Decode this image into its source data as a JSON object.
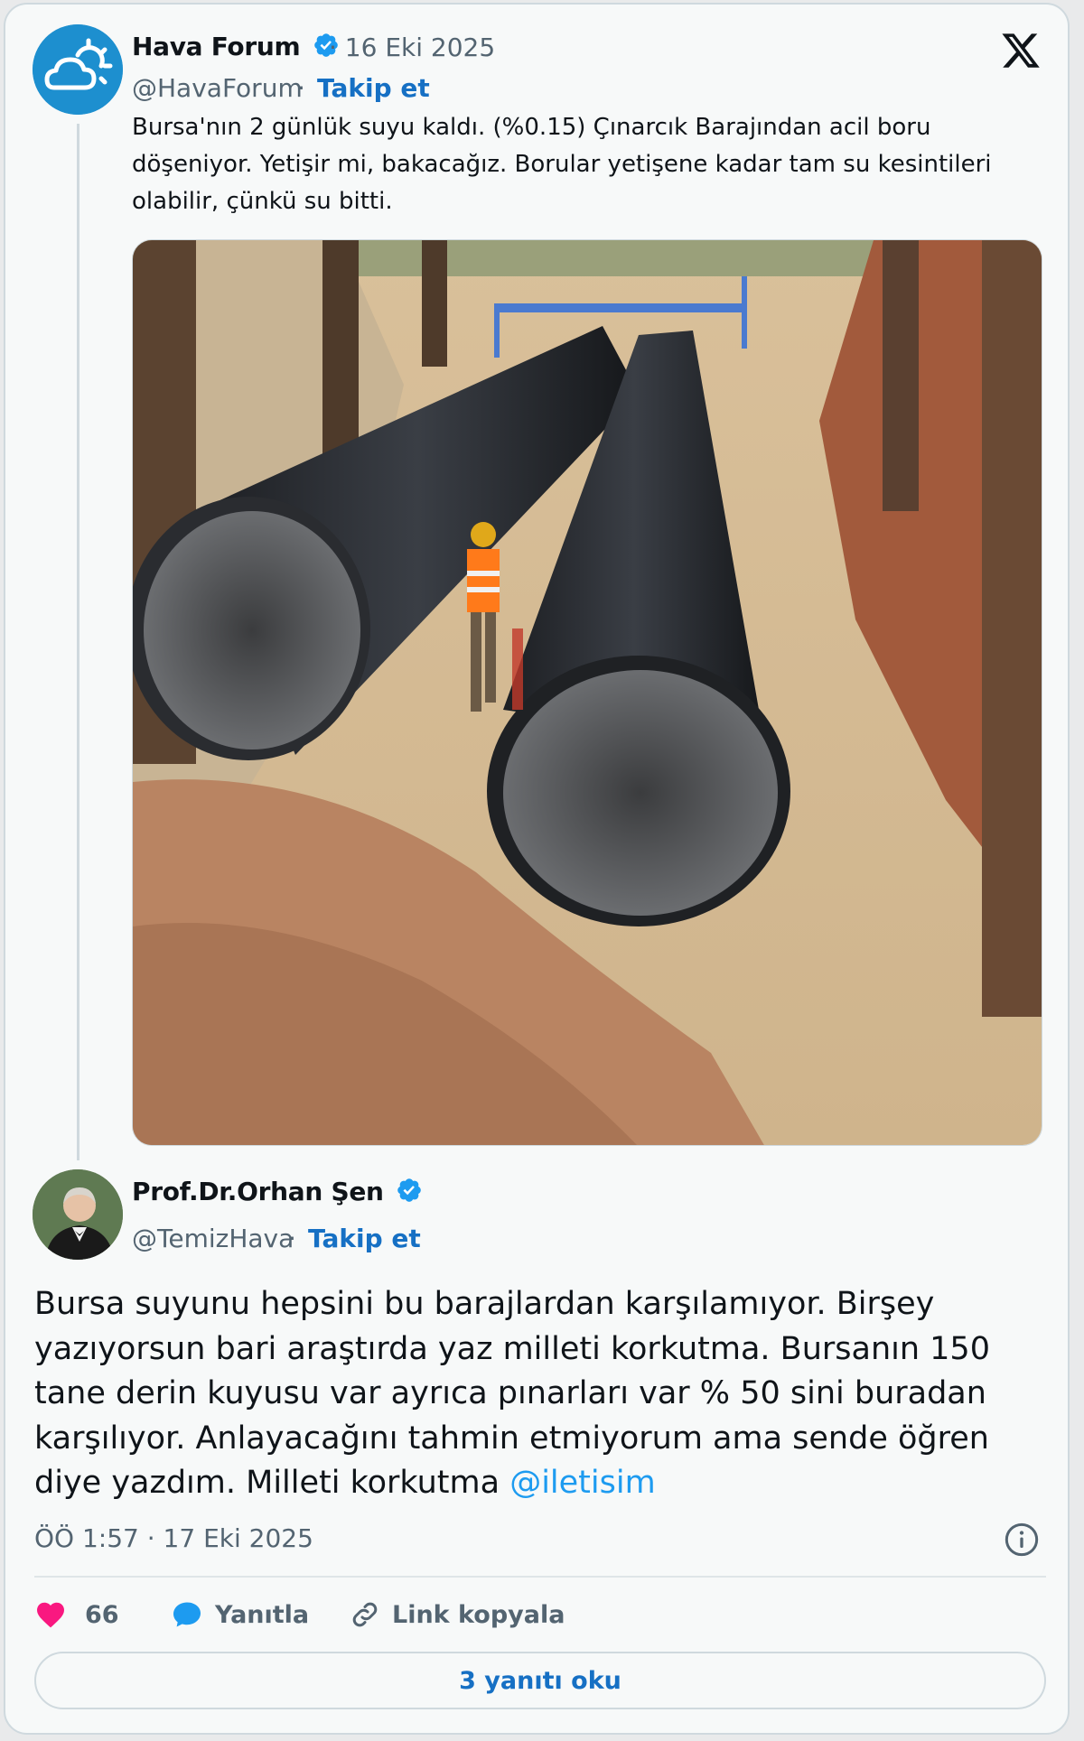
{
  "parent_tweet": {
    "author_name": "Hava Forum",
    "date": "· 16 Eki 2025",
    "handle": "@HavaForum",
    "separator": "·",
    "follow_label": "Takip et",
    "text": "Bursa'nın 2 günlük suyu kaldı. (%0.15) Çınarcık Barajından acil boru döşeniyor. Yetişir mi, bakacağız. Borular yetişene kadar tam su kesintileri olabilir, çünkü su bitti.",
    "avatar_icon": "cloud-sun-icon",
    "photo_icon": "pipeline-trench-photo"
  },
  "reply_tweet": {
    "author_name": "Prof.Dr.Orhan Şen",
    "handle": "@TemizHava",
    "separator": "·",
    "follow_label": "Takip et",
    "text": "Bursa suyunu hepsini bu barajlardan karşılamıyor. Birşey yazıyorsun bari araştırda yaz milleti korkutma. Bursanın 150 tane derin kuyusu var ayrıca pınarları var % 50 sini buradan karşılıyor.  Anlayacağını tahmin etmiyorum ama sende öğren diye yazdım. Milleti korkutma ",
    "mention": "@iletisim",
    "timestamp": "ÖÖ 1:57 · 17 Eki 2025"
  },
  "actions": {
    "like_count": "66",
    "reply_label": "Yanıtla",
    "copy_link_label": "Link kopyala"
  },
  "read_replies_label": "3 yanıtı oku",
  "colors": {
    "accent": "#1d9bf0",
    "link": "#1670c4",
    "like": "#f91880",
    "muted": "#536471"
  }
}
